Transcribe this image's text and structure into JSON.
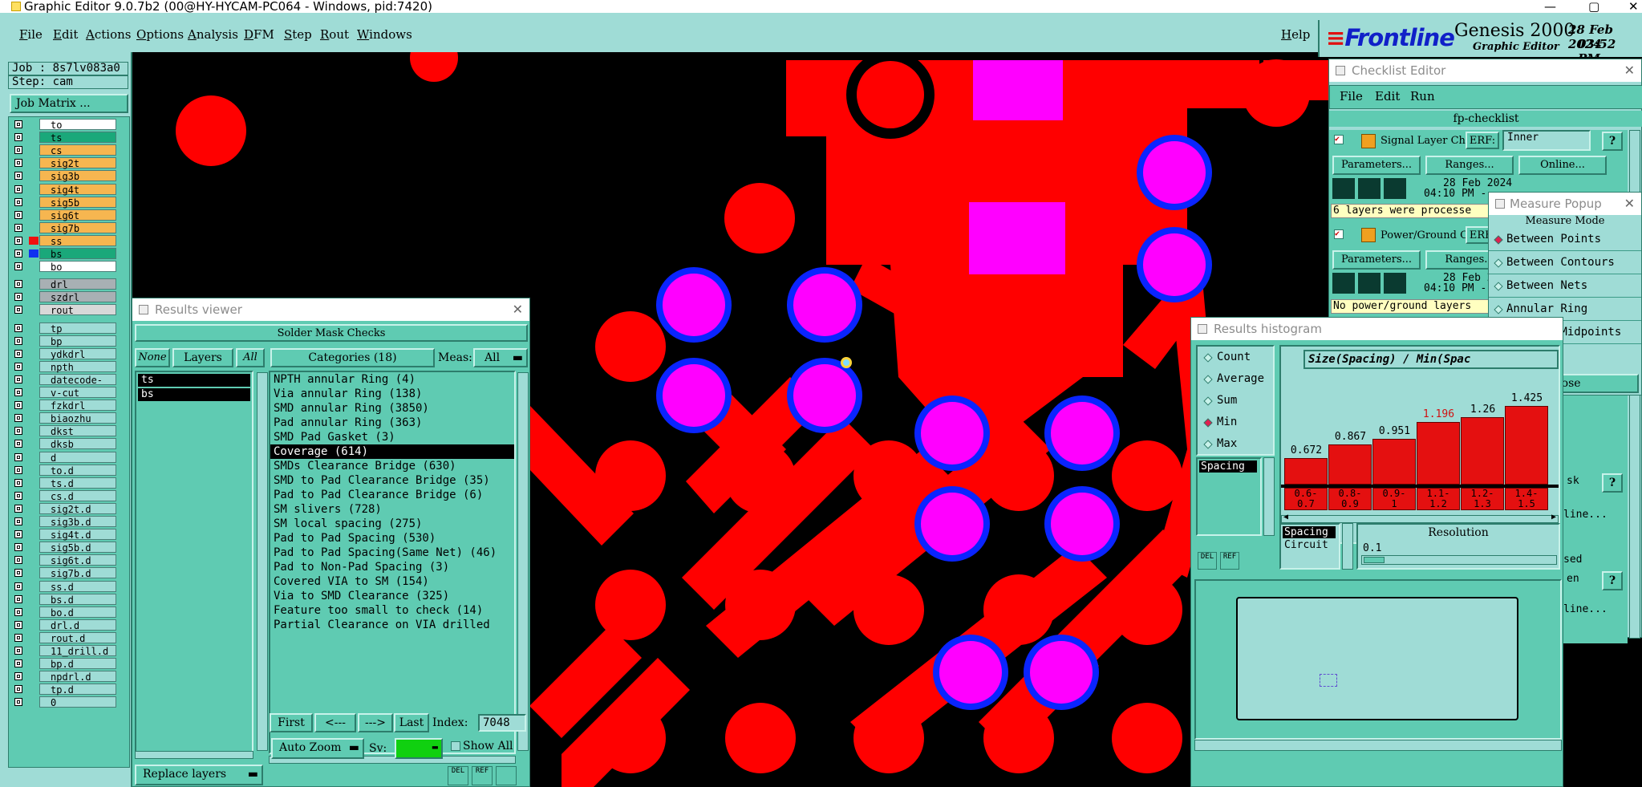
{
  "window": {
    "title": "Graphic Editor 9.0.7b2 (00@HY-HYCAM-PC064 - Windows, pid:7420)"
  },
  "menu": [
    "File",
    "Edit",
    "Actions",
    "Options",
    "Analysis",
    "DFM",
    "Step",
    "Rout",
    "Windows"
  ],
  "help": "Help",
  "brand": {
    "logo": "Frontline",
    "product": "Genesis 2000",
    "sub": "Graphic Editor",
    "date": "28 Feb 2024",
    "time": "03:52 PM"
  },
  "job": {
    "job": "Job : 8s7lv083a0",
    "step": "Step: cam",
    "matrix_btn": "Job Matrix ..."
  },
  "layers": [
    {
      "name": "to",
      "color": "#ffffff"
    },
    {
      "name": "ts",
      "color": "#1aa87a"
    },
    {
      "name": "cs",
      "color": "#f6b650"
    },
    {
      "name": "sig2t",
      "color": "#f6b650"
    },
    {
      "name": "sig3b",
      "color": "#f6b650"
    },
    {
      "name": "sig4t",
      "color": "#f6b650"
    },
    {
      "name": "sig5b",
      "color": "#f6b650"
    },
    {
      "name": "sig6t",
      "color": "#f6b650"
    },
    {
      "name": "sig7b",
      "color": "#f6b650"
    },
    {
      "name": "ss",
      "color": "#f6b650"
    },
    {
      "name": "bs",
      "color": "#1aa87a"
    },
    {
      "name": "bo",
      "color": "#ffffff"
    },
    {
      "name": "drl",
      "color": "#a8b0b4"
    },
    {
      "name": "szdrl",
      "color": "#a8b0b4"
    },
    {
      "name": "rout",
      "color": "#d8d8d8"
    },
    {
      "name": "tp",
      "color": "#9fdcd6"
    },
    {
      "name": "bp",
      "color": "#9fdcd6"
    },
    {
      "name": "ydkdrl",
      "color": "#9fdcd6"
    },
    {
      "name": "npth",
      "color": "#9fdcd6"
    },
    {
      "name": "datecode-pte",
      "color": "#9fdcd6"
    },
    {
      "name": "v-cut",
      "color": "#9fdcd6"
    },
    {
      "name": "fzkdrl",
      "color": "#9fdcd6"
    },
    {
      "name": "biaozhu",
      "color": "#9fdcd6"
    },
    {
      "name": "dkst",
      "color": "#9fdcd6"
    },
    {
      "name": "dksb",
      "color": "#9fdcd6"
    },
    {
      "name": "d",
      "color": "#9fdcd6"
    },
    {
      "name": "to.d",
      "color": "#9fdcd6"
    },
    {
      "name": "ts.d",
      "color": "#9fdcd6"
    },
    {
      "name": "cs.d",
      "color": "#9fdcd6"
    },
    {
      "name": "sig2t.d",
      "color": "#9fdcd6"
    },
    {
      "name": "sig3b.d",
      "color": "#9fdcd6"
    },
    {
      "name": "sig4t.d",
      "color": "#9fdcd6"
    },
    {
      "name": "sig5b.d",
      "color": "#9fdcd6"
    },
    {
      "name": "sig6t.d",
      "color": "#9fdcd6"
    },
    {
      "name": "sig7b.d",
      "color": "#9fdcd6"
    },
    {
      "name": "ss.d",
      "color": "#9fdcd6"
    },
    {
      "name": "bs.d",
      "color": "#9fdcd6"
    },
    {
      "name": "bo.d",
      "color": "#9fdcd6"
    },
    {
      "name": "drl.d",
      "color": "#9fdcd6"
    },
    {
      "name": "rout.d",
      "color": "#9fdcd6"
    },
    {
      "name": "11_drill.d",
      "color": "#9fdcd6"
    },
    {
      "name": "bp.d",
      "color": "#9fdcd6"
    },
    {
      "name": "npdrl.d",
      "color": "#9fdcd6"
    },
    {
      "name": "tp.d",
      "color": "#9fdcd6"
    },
    {
      "name": "0",
      "color": "#9fdcd6"
    }
  ],
  "results_viewer": {
    "title": "Results viewer",
    "header": "Solder Mask Checks",
    "btn_none": "None",
    "btn_layers": "Layers",
    "btn_all": "All",
    "categories_label": "Categories (18)",
    "meas_label": "Meas:",
    "meas_value": "All",
    "layers": [
      "ts",
      "bs"
    ],
    "categories": [
      "NPTH annular Ring (4)",
      "Via annular Ring (138)",
      "SMD annular Ring (3850)",
      "Pad annular Ring (363)",
      "SMD Pad Gasket (3)",
      "Coverage (614)",
      "SMDs Clearance Bridge (630)",
      "SMD to Pad Clearance Bridge (35)",
      "Pad to Pad Clearance Bridge (6)",
      "SM slivers (728)",
      "SM local spacing (275)",
      "Pad to Pad Spacing (530)",
      "Pad to Pad Spacing(Same Net) (46)",
      "Pad to Non-Pad Spacing (3)",
      "Covered VIA to SM (154)",
      "Via to SMD Clearance (325)",
      "Feature too small to check (14)",
      "Partial Clearance on VIA drilled"
    ],
    "selected": 5,
    "nav": [
      "First",
      "<---",
      "--->",
      "Last"
    ],
    "index_label": "Index:",
    "index_value": "7048",
    "zoom": "Auto Zoom",
    "sv": "Sv:",
    "show_all": "Show All",
    "replace": "Replace layers"
  },
  "checklist": {
    "title": "Checklist Editor",
    "menu": [
      "File",
      "Edit",
      "Run"
    ],
    "name": "fp-checklist",
    "item1": "Signal Layer Ch",
    "item2": "Power/Ground C",
    "erf": "ERF:",
    "inner": "Inner",
    "help": "?",
    "btn_params": "Parameters...",
    "btn_ranges": "Ranges...",
    "btn_online": "Online...",
    "date": "28 Feb 2024",
    "time": "04:10 PM -",
    "msg1": "6 layers were processe",
    "msg2": "No power/ground layers",
    "frag1": "sk",
    "frag2": "line...",
    "frag3": "sed",
    "frag4": "en",
    "frag5": "line..."
  },
  "measure": {
    "title": "Measure Popup",
    "mode_label": "Measure Mode",
    "modes": [
      "Between Points",
      "Between Contours",
      "Between Nets",
      "Annular Ring",
      "Between Midpoints"
    ],
    "selected": 0,
    "close": "Close"
  },
  "histogram": {
    "title": "Results histogram",
    "options": [
      "Count",
      "Average",
      "Sum",
      "Min",
      "Max"
    ],
    "selected": 3,
    "list": [
      "Spacing"
    ],
    "header": "Size(Spacing) / Min(Spac",
    "chart_data": {
      "type": "bar",
      "categories": [
        "0.6-0.7",
        "0.8-0.9",
        "0.9-1",
        "1.1-1.2",
        "1.2-1.3",
        "1.4-1.5"
      ],
      "values": [
        0.672,
        0.867,
        0.951,
        1.196,
        1.26,
        1.425
      ],
      "labels": [
        "0.672",
        "0.867",
        "0.951",
        "1.196",
        "1.26",
        "1.425"
      ],
      "bins_top": [
        "0.6-",
        "0.8-",
        "0.9-",
        "1.1-",
        "1.2-",
        "1.4-"
      ],
      "bins_bottom": [
        "0.7",
        "0.9",
        "1",
        "1.2",
        "1.3",
        "1.5"
      ],
      "highlight": 3
    },
    "attrs": [
      "Spacing",
      "Circuit"
    ],
    "resolution_label": "Resolution",
    "resolution": "0.1",
    "del": "DEL",
    "ref": "REF"
  },
  "icons": [
    "close-icon",
    "window-icon",
    "check-icon",
    "help-icon",
    "run-icon"
  ]
}
